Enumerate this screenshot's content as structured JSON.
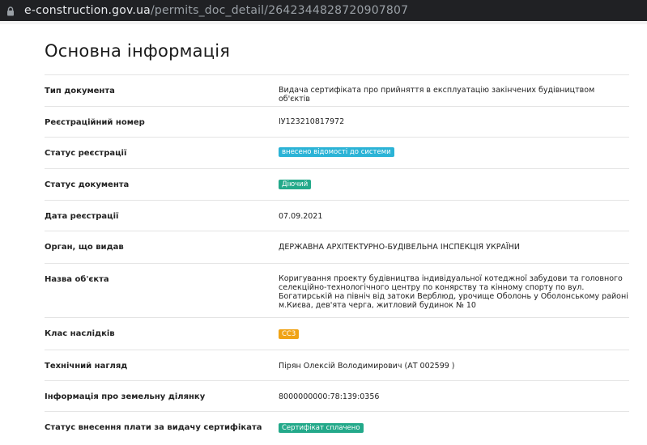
{
  "browser": {
    "url_domain": "e-construction.gov.ua",
    "url_path": "/permits_doc_detail/2642344828720907807",
    "lock_icon": "lock-icon"
  },
  "page": {
    "title": "Основна інформація"
  },
  "rows": [
    {
      "label": "Тип документа",
      "value": "Видача сертифіката про прийняття в експлуатацію закінчених будівництвом об'єктів"
    },
    {
      "label": "Реєстраційний номер",
      "value": "ІУ123210817972"
    },
    {
      "label": "Статус реєстрації",
      "badge": "внесено відомості до системи",
      "badge_color": "#2bb3d6"
    },
    {
      "label": "Статус документа",
      "badge": "Діючий",
      "badge_color": "#23a98a"
    },
    {
      "label": "Дата реєстрації",
      "value": "07.09.2021"
    },
    {
      "label": "Орган, що видав",
      "value": "ДЕРЖАВНА АРХІТЕКТУРНО-БУДІВЕЛЬНА ІНСПЕКЦІЯ УКРАЇНИ"
    },
    {
      "label": "Назва об'єкта",
      "value": "Коригування проекту будівництва індивідуальної котеджної забудови та головного селекційно-технологічного центру по конярству та кінному спорту по вул. Богатирській на північ від затоки Верблюд, урочище Оболонь у Оболонському районі м.Києва, дев'ята черга, житловий будинок № 10"
    },
    {
      "label": "Клас наслідків",
      "badge": "СС3",
      "badge_color": "#f0a316"
    },
    {
      "label": "Технічний нагляд",
      "value": "Пірян Олексій Володимирович (АТ 002599 )"
    },
    {
      "label": "Інформація про земельну ділянку",
      "value": "8000000000:78:139:0356"
    },
    {
      "label": "Статус внесення плати за видачу сертифіката",
      "badge": "Сертифікат сплачено",
      "badge_color": "#23a98a"
    }
  ]
}
